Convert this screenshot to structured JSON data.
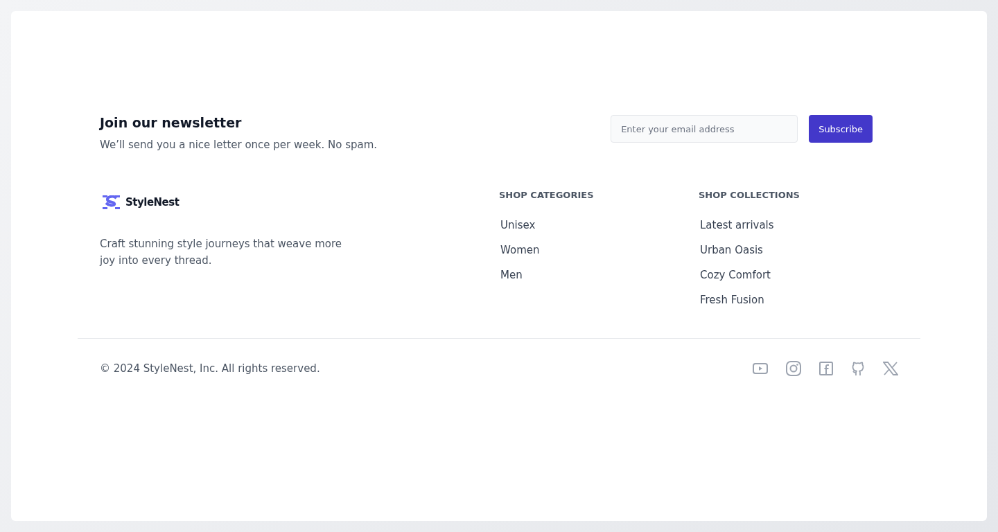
{
  "newsletter": {
    "title": "Join our newsletter",
    "text": "We’ll send you a nice letter once per week. No spam.",
    "email": {
      "placeholder": "Enter your email address"
    },
    "button": "Subscribe"
  },
  "brand": {
    "name": "StyleNest",
    "tagline": "Craft stunning style journeys that weave more joy into every thread."
  },
  "columns": [
    {
      "heading": "SHOP CATEGORIES",
      "links": [
        "Unisex",
        "Women",
        "Men"
      ]
    },
    {
      "heading": "SHOP COLLECTIONS",
      "links": [
        "Latest arrivals",
        "Urban Oasis",
        "Cozy Comfort",
        "Fresh Fusion"
      ]
    }
  ],
  "copyright": "© 2024 StyleNest, Inc. All rights reserved.",
  "socials": [
    {
      "kind": "video"
    },
    {
      "kind": "camera"
    },
    {
      "kind": "letter"
    },
    {
      "kind": "cat"
    },
    {
      "kind": "x"
    }
  ]
}
